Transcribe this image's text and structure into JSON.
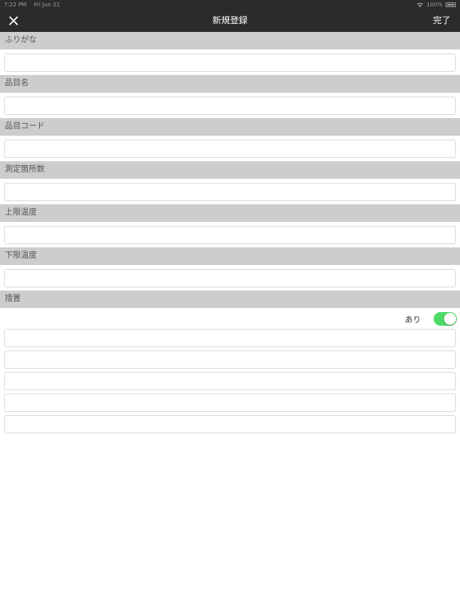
{
  "status_bar": {
    "time": "7:22 PM",
    "date": "Fri Jun 21",
    "battery": "100%"
  },
  "nav": {
    "title": "新規登録",
    "done_label": "完了",
    "close_icon": "close-icon"
  },
  "form": {
    "furigana": {
      "label": "ふりがな",
      "value": ""
    },
    "item_name": {
      "label": "品目名",
      "value": ""
    },
    "item_code": {
      "label": "品目コード",
      "value": ""
    },
    "measure_points": {
      "label": "測定箇所数",
      "value": ""
    },
    "upper_temp": {
      "label": "上限温度",
      "value": ""
    },
    "lower_temp": {
      "label": "下限温度",
      "value": ""
    },
    "action": {
      "label": "措置",
      "toggle_label": "あり",
      "toggle_on": true,
      "toggle_color": "#4cd964",
      "inputs": [
        "",
        "",
        "",
        "",
        ""
      ]
    }
  },
  "colors": {
    "bar": "#2b2b2b",
    "section_header": "#cdcdcd"
  }
}
